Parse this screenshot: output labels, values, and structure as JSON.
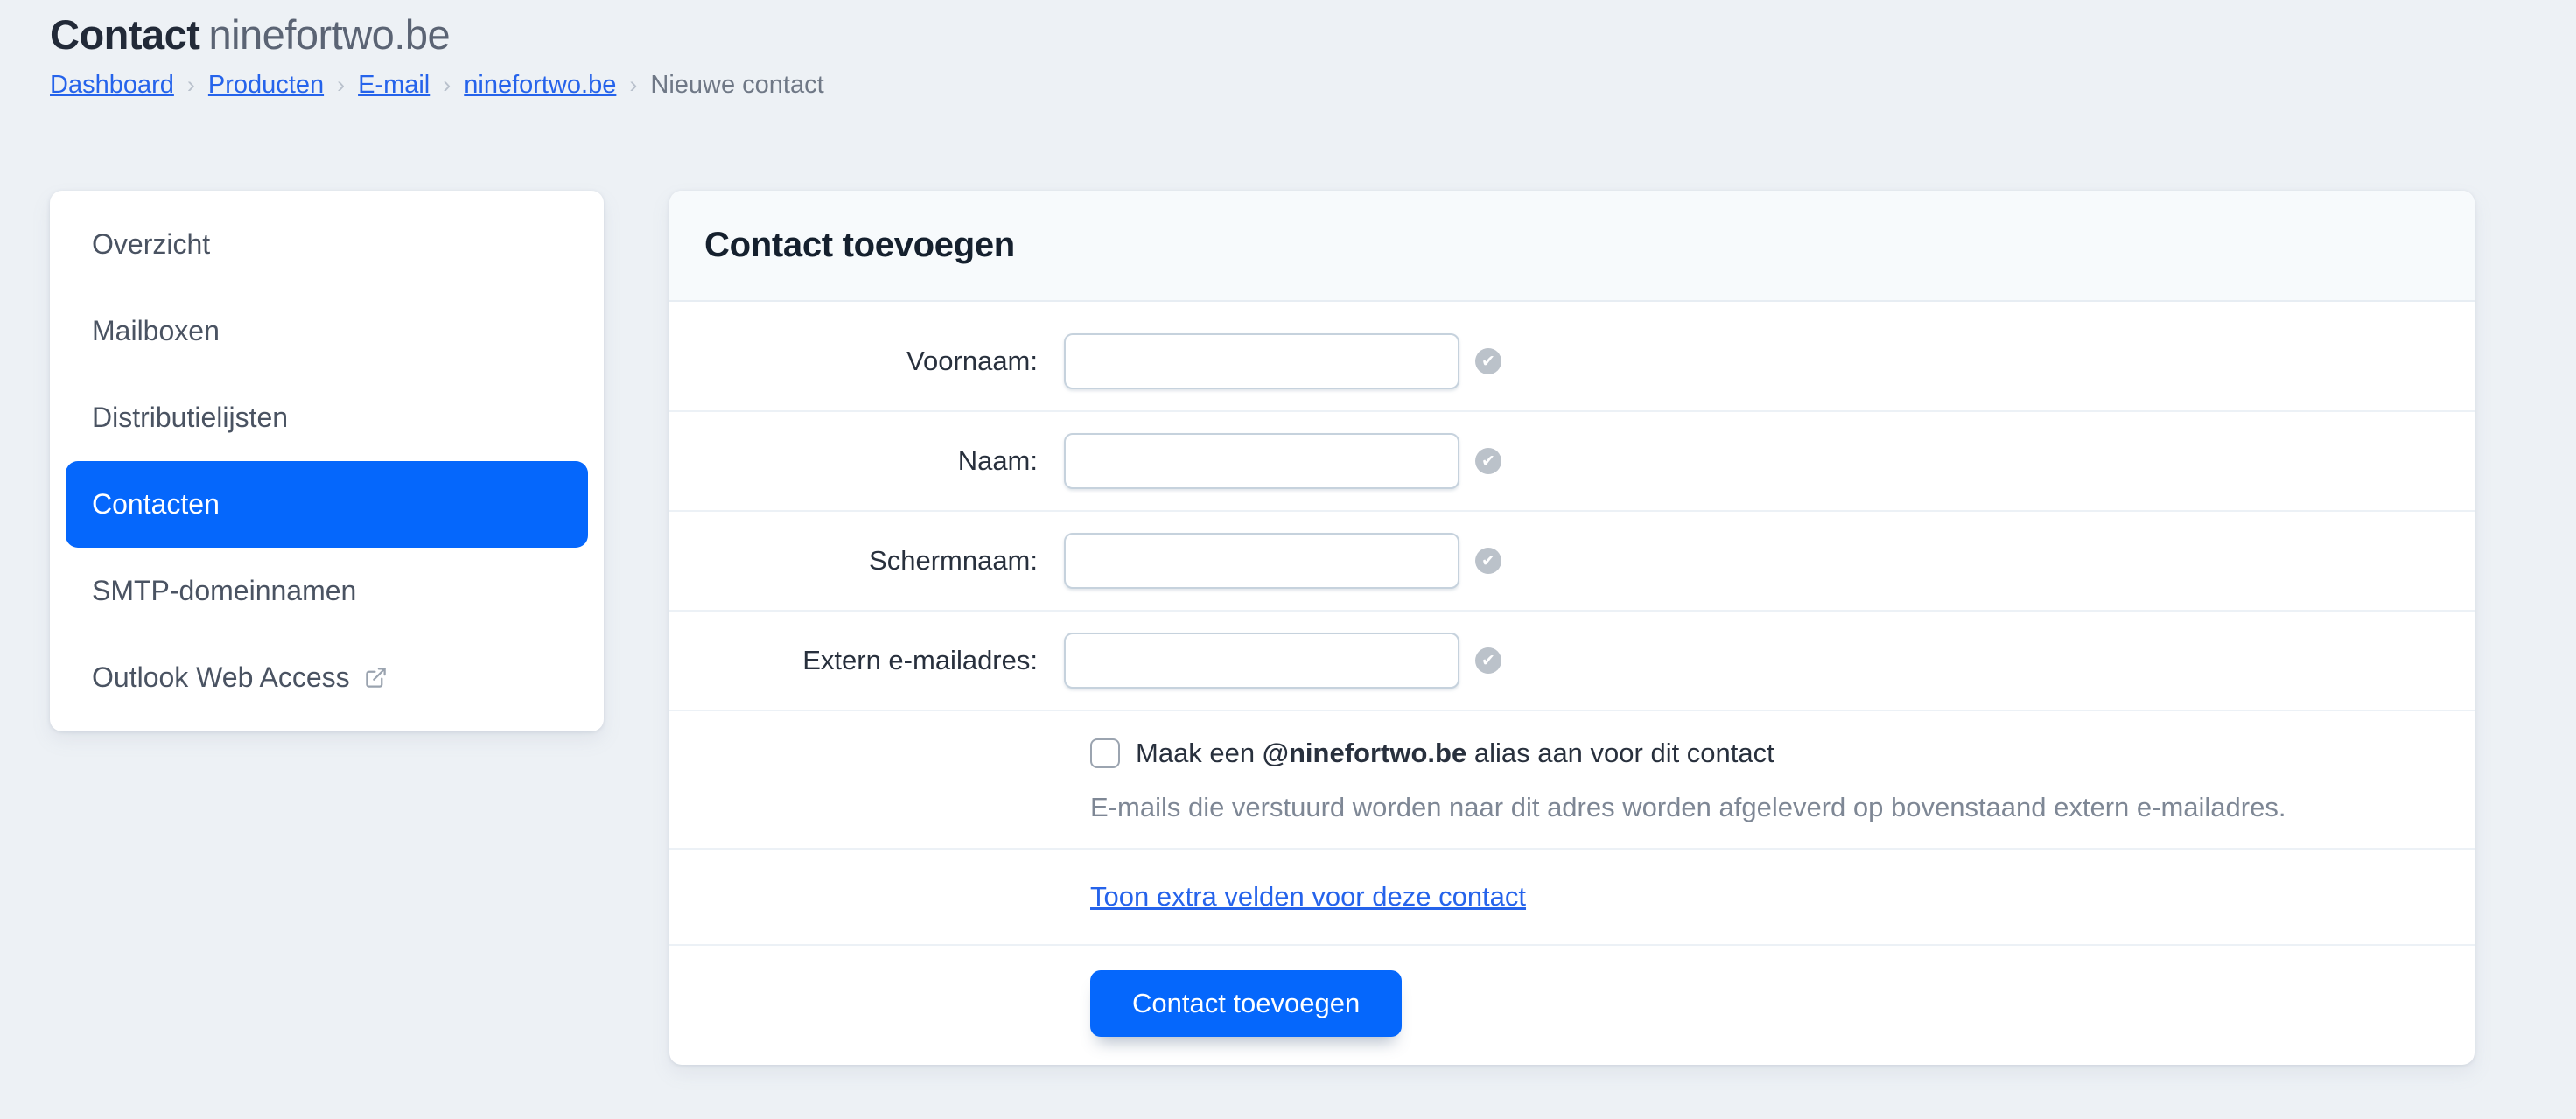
{
  "header": {
    "title_primary": "Contact",
    "title_domain": "ninefortwo.be"
  },
  "breadcrumb": {
    "links": [
      "Dashboard",
      "Producten",
      "E-mail",
      "ninefortwo.be"
    ],
    "separator": "›",
    "current": "Nieuwe contact"
  },
  "sidebar": {
    "items": [
      {
        "label": "Overzicht",
        "active": false
      },
      {
        "label": "Mailboxen",
        "active": false
      },
      {
        "label": "Distributielijsten",
        "active": false
      },
      {
        "label": "Contacten",
        "active": true
      },
      {
        "label": "SMTP-domeinnamen",
        "active": false
      },
      {
        "label": "Outlook Web Access",
        "active": false,
        "external": true
      }
    ]
  },
  "panel": {
    "title": "Contact toevoegen",
    "fields": [
      {
        "label": "Voornaam:",
        "value": "",
        "status_icon": "check-circle"
      },
      {
        "label": "Naam:",
        "value": "",
        "status_icon": "check-circle"
      },
      {
        "label": "Schermnaam:",
        "value": "",
        "status_icon": "check-circle"
      },
      {
        "label": "Extern e-mailadres:",
        "value": "",
        "status_icon": "check-circle"
      }
    ],
    "alias_checkbox": {
      "checked": false,
      "label_prefix": "Maak een ",
      "label_bold": "@ninefortwo.be",
      "label_suffix": " alias aan voor dit contact",
      "help_text": "E-mails die verstuurd worden naar dit adres worden afgeleverd op bovenstaand extern e-mailadres."
    },
    "extra_fields_link": "Toon extra velden voor deze contact",
    "submit_label": "Contact toevoegen"
  },
  "icons": {
    "check_glyph": "✔",
    "external_link": "external-link-icon"
  },
  "colors": {
    "page_background": "#edf1f5",
    "accent_blue": "#0567fc",
    "link_blue": "#2563eb",
    "panel_header_bg": "#f7fafc",
    "divider": "#ecf1f6",
    "input_border": "#c6d2dd",
    "muted_text": "#7e8795",
    "status_icon_gray": "#b6bdc6"
  }
}
